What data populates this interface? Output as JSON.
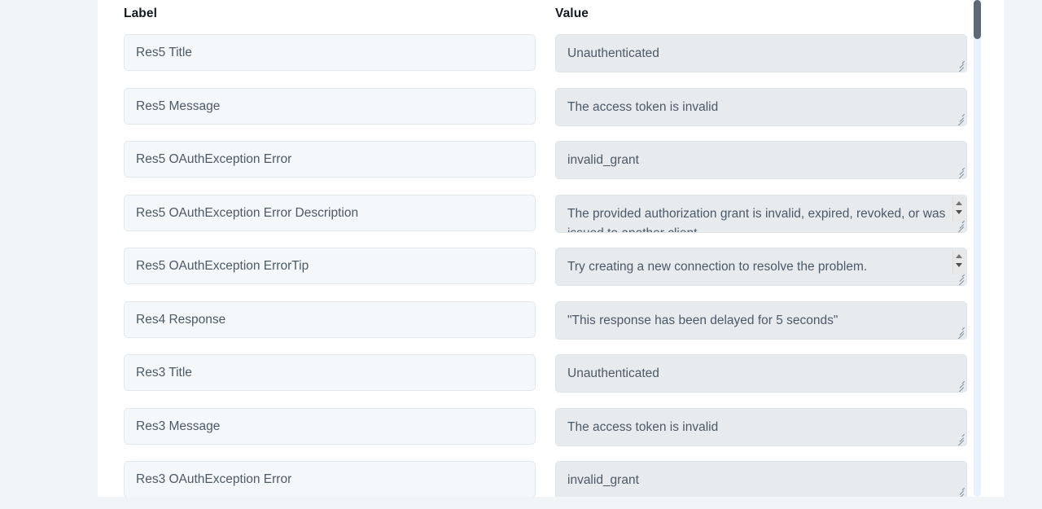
{
  "columns": {
    "label_header": "Label",
    "value_header": "Value"
  },
  "colors": {
    "page_background": "#f1f5f8",
    "panel_background": "#ffffff",
    "label_field_background": "#f5f8fa",
    "value_field_background": "#e7ebee",
    "field_text": "#4c5967",
    "header_text": "#13181f",
    "scrollbar_track": "#e9f1fd",
    "scrollbar_thumb": "#5b6876"
  },
  "scrollbar": {
    "orientation": "vertical",
    "position": "top"
  },
  "rows": [
    {
      "label": "Res5 Title",
      "value": "Unauthenticated",
      "overflow": false
    },
    {
      "label": "Res5 Message",
      "value": "The access token is invalid",
      "overflow": false
    },
    {
      "label": "Res5 OAuthException Error",
      "value": "invalid_grant",
      "overflow": false
    },
    {
      "label": "Res5 OAuthException Error Description",
      "value": "The provided authorization grant is invalid, expired, revoked, or was issued to another client.",
      "overflow": true
    },
    {
      "label": "Res5 OAuthException ErrorTip",
      "value": "Try creating a new connection to resolve the problem.",
      "overflow": true
    },
    {
      "label": "Res4 Response",
      "value": "\"This response has been delayed for 5 seconds\"",
      "overflow": false
    },
    {
      "label": "Res3 Title",
      "value": "Unauthenticated",
      "overflow": false
    },
    {
      "label": "Res3 Message",
      "value": "The access token is invalid",
      "overflow": false
    },
    {
      "label": "Res3 OAuthException Error",
      "value": "invalid_grant",
      "overflow": false
    }
  ]
}
